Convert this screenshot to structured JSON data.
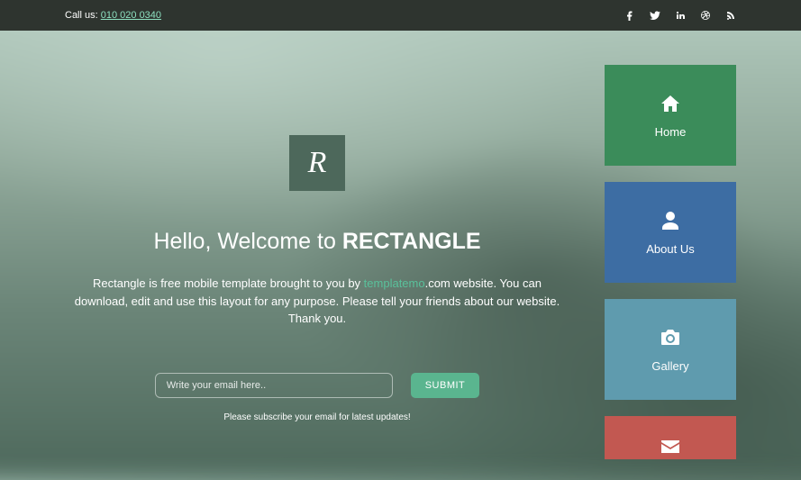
{
  "topbar": {
    "call_label": "Call us:",
    "phone": "010 020 0340"
  },
  "hero": {
    "logo_glyph": "R",
    "headline_prefix": "Hello, Welcome to ",
    "headline_brand": "RECTANGLE",
    "desc_pre": "Rectangle is free mobile template brought to you by ",
    "desc_link": "templatemo",
    "desc_post": ".com website. You can download, edit and use this layout for any purpose. Please tell your friends about our website. Thank you.",
    "email_placeholder": "Write your email here..",
    "submit_label": "SUBMIT",
    "note": "Please subscribe your email for latest updates!"
  },
  "nav": {
    "home": "Home",
    "about": "About Us",
    "gallery": "Gallery"
  }
}
